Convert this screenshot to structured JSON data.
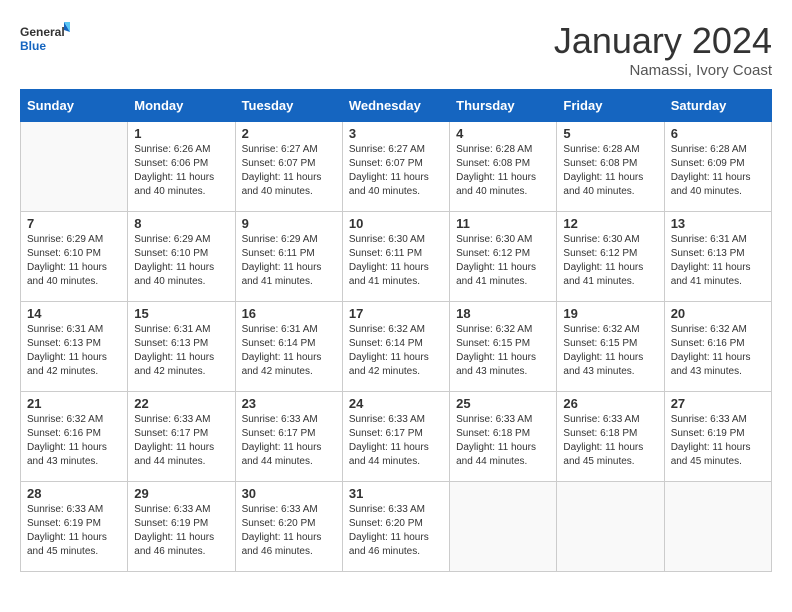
{
  "header": {
    "logo_general": "General",
    "logo_blue": "Blue",
    "month_title": "January 2024",
    "location": "Namassi, Ivory Coast"
  },
  "weekdays": [
    "Sunday",
    "Monday",
    "Tuesday",
    "Wednesday",
    "Thursday",
    "Friday",
    "Saturday"
  ],
  "weeks": [
    [
      {
        "day": "",
        "sunrise": "",
        "sunset": "",
        "daylight": ""
      },
      {
        "day": "1",
        "sunrise": "Sunrise: 6:26 AM",
        "sunset": "Sunset: 6:06 PM",
        "daylight": "Daylight: 11 hours and 40 minutes."
      },
      {
        "day": "2",
        "sunrise": "Sunrise: 6:27 AM",
        "sunset": "Sunset: 6:07 PM",
        "daylight": "Daylight: 11 hours and 40 minutes."
      },
      {
        "day": "3",
        "sunrise": "Sunrise: 6:27 AM",
        "sunset": "Sunset: 6:07 PM",
        "daylight": "Daylight: 11 hours and 40 minutes."
      },
      {
        "day": "4",
        "sunrise": "Sunrise: 6:28 AM",
        "sunset": "Sunset: 6:08 PM",
        "daylight": "Daylight: 11 hours and 40 minutes."
      },
      {
        "day": "5",
        "sunrise": "Sunrise: 6:28 AM",
        "sunset": "Sunset: 6:08 PM",
        "daylight": "Daylight: 11 hours and 40 minutes."
      },
      {
        "day": "6",
        "sunrise": "Sunrise: 6:28 AM",
        "sunset": "Sunset: 6:09 PM",
        "daylight": "Daylight: 11 hours and 40 minutes."
      }
    ],
    [
      {
        "day": "7",
        "sunrise": "Sunrise: 6:29 AM",
        "sunset": "Sunset: 6:10 PM",
        "daylight": "Daylight: 11 hours and 40 minutes."
      },
      {
        "day": "8",
        "sunrise": "Sunrise: 6:29 AM",
        "sunset": "Sunset: 6:10 PM",
        "daylight": "Daylight: 11 hours and 40 minutes."
      },
      {
        "day": "9",
        "sunrise": "Sunrise: 6:29 AM",
        "sunset": "Sunset: 6:11 PM",
        "daylight": "Daylight: 11 hours and 41 minutes."
      },
      {
        "day": "10",
        "sunrise": "Sunrise: 6:30 AM",
        "sunset": "Sunset: 6:11 PM",
        "daylight": "Daylight: 11 hours and 41 minutes."
      },
      {
        "day": "11",
        "sunrise": "Sunrise: 6:30 AM",
        "sunset": "Sunset: 6:12 PM",
        "daylight": "Daylight: 11 hours and 41 minutes."
      },
      {
        "day": "12",
        "sunrise": "Sunrise: 6:30 AM",
        "sunset": "Sunset: 6:12 PM",
        "daylight": "Daylight: 11 hours and 41 minutes."
      },
      {
        "day": "13",
        "sunrise": "Sunrise: 6:31 AM",
        "sunset": "Sunset: 6:13 PM",
        "daylight": "Daylight: 11 hours and 41 minutes."
      }
    ],
    [
      {
        "day": "14",
        "sunrise": "Sunrise: 6:31 AM",
        "sunset": "Sunset: 6:13 PM",
        "daylight": "Daylight: 11 hours and 42 minutes."
      },
      {
        "day": "15",
        "sunrise": "Sunrise: 6:31 AM",
        "sunset": "Sunset: 6:13 PM",
        "daylight": "Daylight: 11 hours and 42 minutes."
      },
      {
        "day": "16",
        "sunrise": "Sunrise: 6:31 AM",
        "sunset": "Sunset: 6:14 PM",
        "daylight": "Daylight: 11 hours and 42 minutes."
      },
      {
        "day": "17",
        "sunrise": "Sunrise: 6:32 AM",
        "sunset": "Sunset: 6:14 PM",
        "daylight": "Daylight: 11 hours and 42 minutes."
      },
      {
        "day": "18",
        "sunrise": "Sunrise: 6:32 AM",
        "sunset": "Sunset: 6:15 PM",
        "daylight": "Daylight: 11 hours and 43 minutes."
      },
      {
        "day": "19",
        "sunrise": "Sunrise: 6:32 AM",
        "sunset": "Sunset: 6:15 PM",
        "daylight": "Daylight: 11 hours and 43 minutes."
      },
      {
        "day": "20",
        "sunrise": "Sunrise: 6:32 AM",
        "sunset": "Sunset: 6:16 PM",
        "daylight": "Daylight: 11 hours and 43 minutes."
      }
    ],
    [
      {
        "day": "21",
        "sunrise": "Sunrise: 6:32 AM",
        "sunset": "Sunset: 6:16 PM",
        "daylight": "Daylight: 11 hours and 43 minutes."
      },
      {
        "day": "22",
        "sunrise": "Sunrise: 6:33 AM",
        "sunset": "Sunset: 6:17 PM",
        "daylight": "Daylight: 11 hours and 44 minutes."
      },
      {
        "day": "23",
        "sunrise": "Sunrise: 6:33 AM",
        "sunset": "Sunset: 6:17 PM",
        "daylight": "Daylight: 11 hours and 44 minutes."
      },
      {
        "day": "24",
        "sunrise": "Sunrise: 6:33 AM",
        "sunset": "Sunset: 6:17 PM",
        "daylight": "Daylight: 11 hours and 44 minutes."
      },
      {
        "day": "25",
        "sunrise": "Sunrise: 6:33 AM",
        "sunset": "Sunset: 6:18 PM",
        "daylight": "Daylight: 11 hours and 44 minutes."
      },
      {
        "day": "26",
        "sunrise": "Sunrise: 6:33 AM",
        "sunset": "Sunset: 6:18 PM",
        "daylight": "Daylight: 11 hours and 45 minutes."
      },
      {
        "day": "27",
        "sunrise": "Sunrise: 6:33 AM",
        "sunset": "Sunset: 6:19 PM",
        "daylight": "Daylight: 11 hours and 45 minutes."
      }
    ],
    [
      {
        "day": "28",
        "sunrise": "Sunrise: 6:33 AM",
        "sunset": "Sunset: 6:19 PM",
        "daylight": "Daylight: 11 hours and 45 minutes."
      },
      {
        "day": "29",
        "sunrise": "Sunrise: 6:33 AM",
        "sunset": "Sunset: 6:19 PM",
        "daylight": "Daylight: 11 hours and 46 minutes."
      },
      {
        "day": "30",
        "sunrise": "Sunrise: 6:33 AM",
        "sunset": "Sunset: 6:20 PM",
        "daylight": "Daylight: 11 hours and 46 minutes."
      },
      {
        "day": "31",
        "sunrise": "Sunrise: 6:33 AM",
        "sunset": "Sunset: 6:20 PM",
        "daylight": "Daylight: 11 hours and 46 minutes."
      },
      {
        "day": "",
        "sunrise": "",
        "sunset": "",
        "daylight": ""
      },
      {
        "day": "",
        "sunrise": "",
        "sunset": "",
        "daylight": ""
      },
      {
        "day": "",
        "sunrise": "",
        "sunset": "",
        "daylight": ""
      }
    ]
  ]
}
